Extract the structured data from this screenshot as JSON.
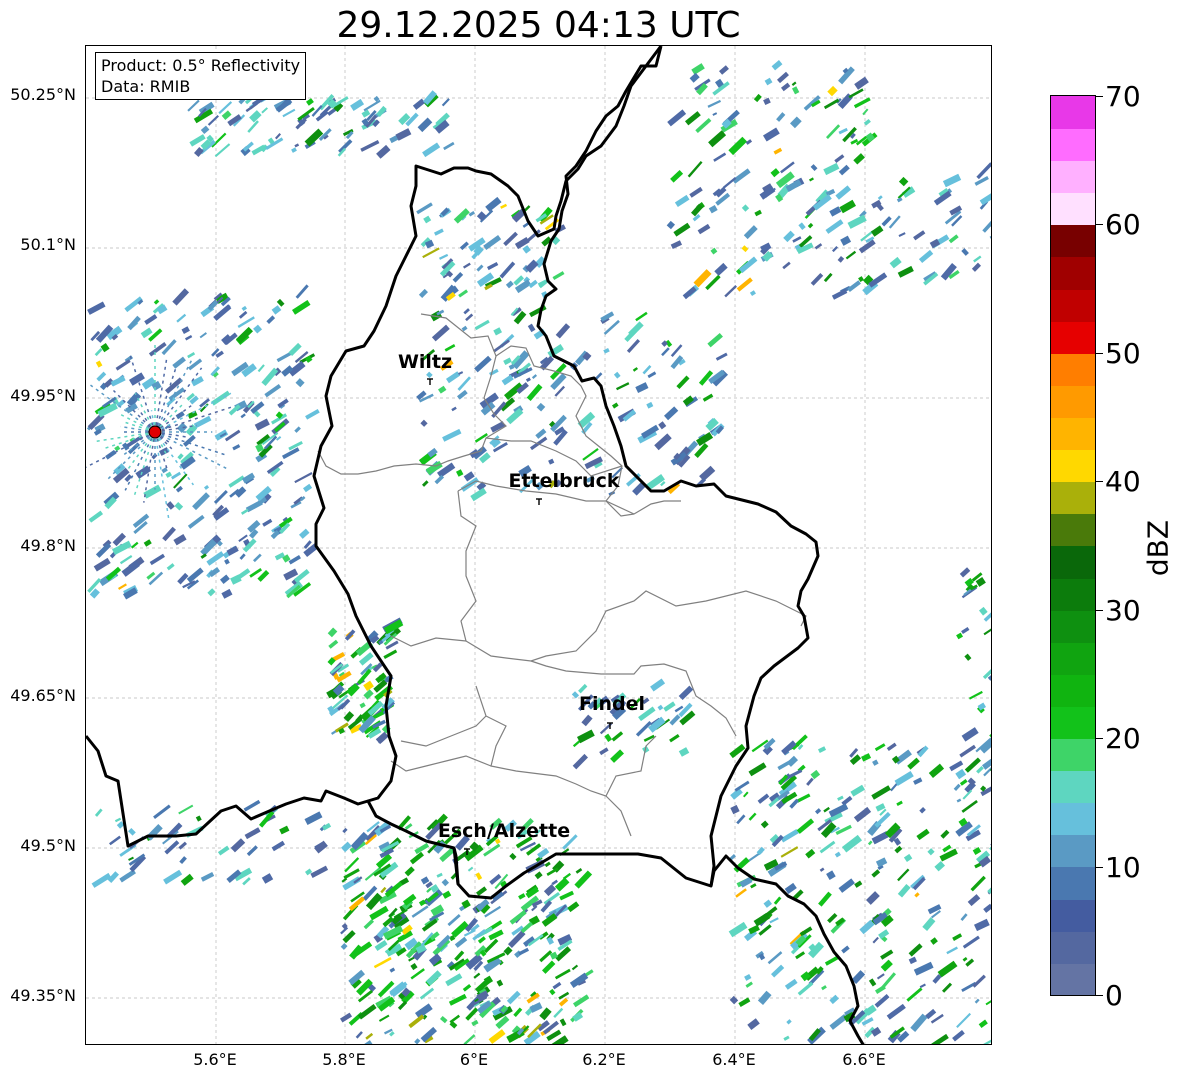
{
  "title": "29.12.2025 04:13 UTC",
  "info": {
    "product": "Product: 0.5° Reflectivity",
    "source": "Data: RMIB"
  },
  "lat_labels": [
    "50.25°N",
    "50.1°N",
    "49.95°N",
    "49.8°N",
    "49.65°N",
    "49.5°N",
    "49.35°N"
  ],
  "lon_labels": [
    "5.6°E",
    "5.8°E",
    "6°E",
    "6.2°E",
    "6.4°E",
    "6.6°E"
  ],
  "cities": [
    "Wiltz",
    "Ettelbruck",
    "Findel",
    "Esch/Alzette"
  ],
  "colorbar": {
    "label": "dBZ",
    "ticks": [
      "0",
      "10",
      "20",
      "30",
      "40",
      "50",
      "60",
      "70"
    ],
    "colors": [
      "#6474a4",
      "#5468a0",
      "#445ca0",
      "#4a78b0",
      "#5a9ac4",
      "#66c0dc",
      "#5ed6c0",
      "#3ed468",
      "#12c21a",
      "#10b410",
      "#10a410",
      "#0e9010",
      "#0c7c0c",
      "#0a680a",
      "#4a7a0a",
      "#aab00a",
      "#ffd800",
      "#ffb400",
      "#ff9a00",
      "#ff7e00",
      "#e60000",
      "#c00000",
      "#a00000",
      "#780000",
      "#ffe0ff",
      "#ffb0ff",
      "#ff6cff",
      "#e838e8"
    ]
  },
  "colors": {
    "border": "#000000",
    "districts": "#808080",
    "radar_site": "#e00000"
  }
}
